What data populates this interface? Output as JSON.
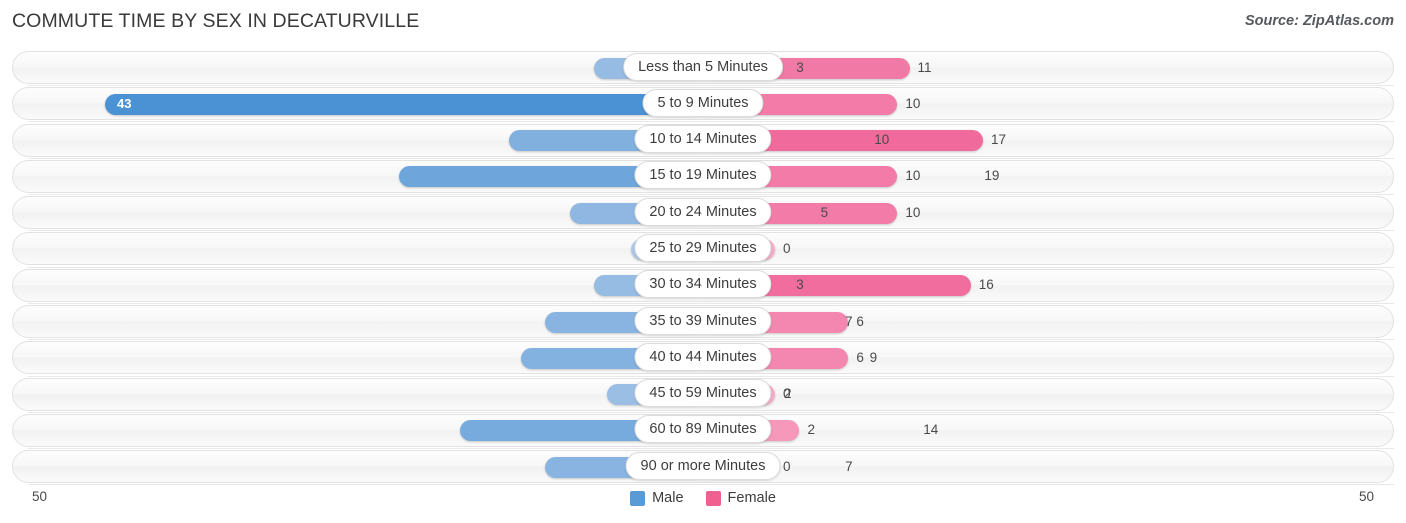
{
  "header": {
    "title": "COMMUTE TIME BY SEX IN DECATURVILLE",
    "source": "Source: ZipAtlas.com"
  },
  "legend": {
    "male_label": "Male",
    "female_label": "Female",
    "male_color": "#5b9bd5",
    "female_color": "#ef5f8f"
  },
  "axis": {
    "left_label": "50",
    "right_label": "50",
    "max": 50
  },
  "chart_data": {
    "type": "bar",
    "title": "COMMUTE TIME BY SEX IN DECATURVILLE",
    "subtitle": "Source: ZipAtlas.com",
    "orientation": "horizontal-diverging",
    "xlabel": "",
    "ylabel": "",
    "xlim": [
      -50,
      50
    ],
    "grid": false,
    "legend_position": "bottom-center",
    "categories": [
      "Less than 5 Minutes",
      "5 to 9 Minutes",
      "10 to 14 Minutes",
      "15 to 19 Minutes",
      "20 to 24 Minutes",
      "25 to 29 Minutes",
      "30 to 34 Minutes",
      "35 to 39 Minutes",
      "40 to 44 Minutes",
      "45 to 59 Minutes",
      "60 to 89 Minutes",
      "90 or more Minutes"
    ],
    "series": [
      {
        "name": "Male",
        "color": "#5b9bd5",
        "side": "left",
        "values": [
          3,
          43,
          10,
          19,
          5,
          0,
          3,
          7,
          9,
          2,
          14,
          7
        ]
      },
      {
        "name": "Female",
        "color": "#ef5f8f",
        "side": "right",
        "values": [
          11,
          10,
          17,
          10,
          10,
          0,
          16,
          6,
          6,
          0,
          2,
          0
        ]
      }
    ]
  }
}
